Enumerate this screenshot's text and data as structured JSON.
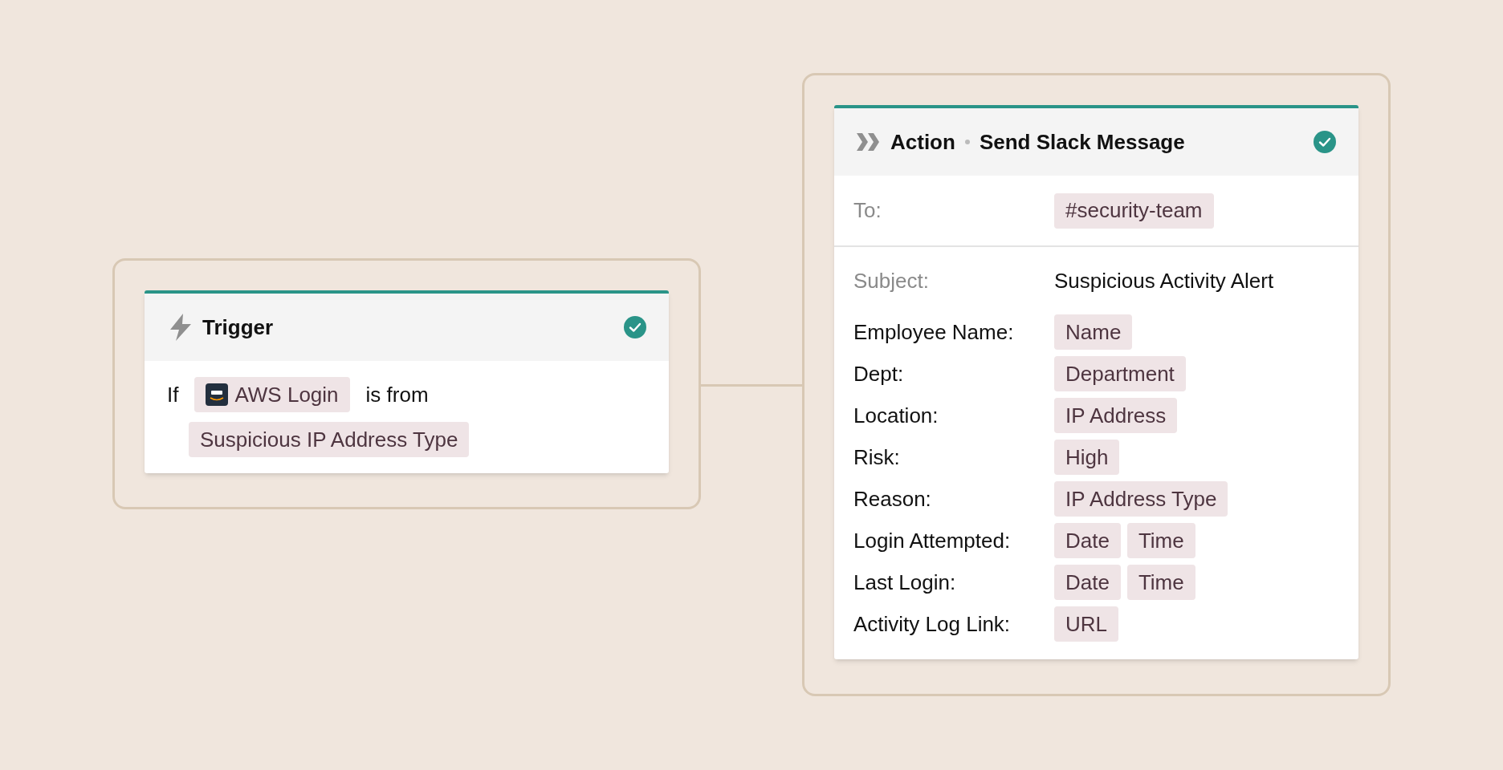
{
  "trigger": {
    "title": "Trigger",
    "completed": true,
    "lines": [
      [
        {
          "kind": "text",
          "text": "If"
        },
        {
          "kind": "chip",
          "text": "AWS Login",
          "logo": true
        },
        {
          "kind": "text",
          "text": "is from"
        }
      ],
      [
        {
          "kind": "chip",
          "text": "Suspicious IP Address Type",
          "logo": false
        }
      ]
    ]
  },
  "action": {
    "kind_label": "Action",
    "title": "Send Slack Message",
    "completed": true,
    "to": {
      "label": "To:",
      "chips": [
        "#security-team"
      ]
    },
    "subject": {
      "label": "Subject:",
      "value": "Suspicious Activity Alert"
    },
    "fields": [
      {
        "label": "Employee Name:",
        "chips": [
          "Name"
        ]
      },
      {
        "label": "Dept:",
        "chips": [
          "Department"
        ]
      },
      {
        "label": "Location:",
        "chips": [
          "IP Address"
        ]
      },
      {
        "label": "Risk:",
        "chips": [
          "High"
        ]
      },
      {
        "label": "Reason:",
        "chips": [
          "IP Address Type"
        ]
      },
      {
        "label": "Login Attempted:",
        "chips": [
          "Date",
          "Time"
        ]
      },
      {
        "label": "Last Login:",
        "chips": [
          "Date",
          "Time"
        ]
      },
      {
        "label": "Activity Log Link:",
        "chips": [
          "URL"
        ]
      }
    ]
  }
}
